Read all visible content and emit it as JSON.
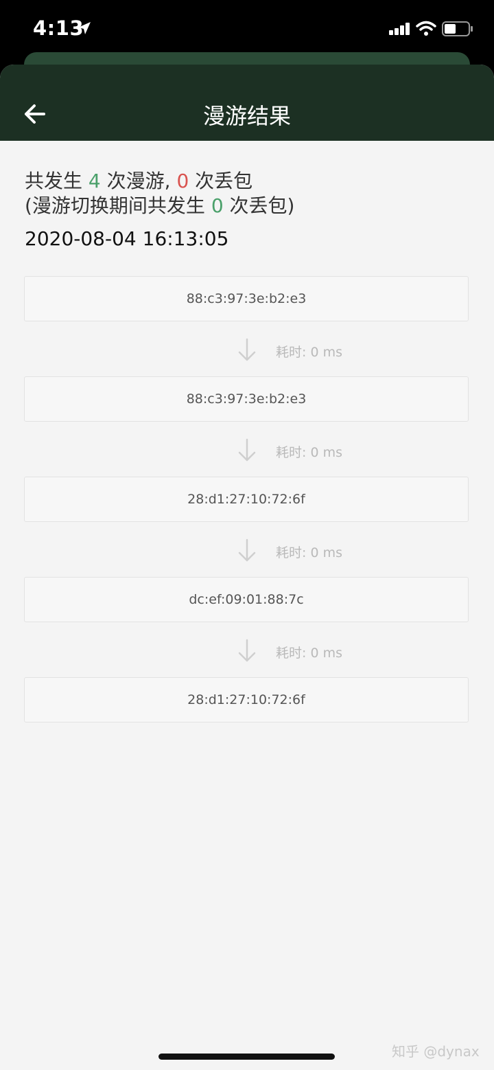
{
  "status_bar": {
    "time": "4:13",
    "icons": [
      "location-arrow-icon",
      "cellular-signal-icon",
      "wifi-icon",
      "battery-icon"
    ]
  },
  "nav": {
    "title": "漫游结果",
    "back_icon": "arrow-left-icon"
  },
  "summary": {
    "line1_prefix": "共发生 ",
    "roam_count": "4",
    "line1_mid": " 次漫游, ",
    "loss_count": "0",
    "line1_suffix": " 次丢包",
    "line2_prefix": "(漫游切换期间共发生 ",
    "switch_loss_count": "0",
    "line2_suffix": " 次丢包)",
    "datetime": "2020-08-04 16:13:05"
  },
  "nodes": [
    {
      "mac": "88:c3:97:3e:b2:e3"
    },
    {
      "mac": "88:c3:97:3e:b2:e3"
    },
    {
      "mac": "28:d1:27:10:72:6f"
    },
    {
      "mac": "dc:ef:09:01:88:7c"
    },
    {
      "mac": "28:d1:27:10:72:6f"
    }
  ],
  "transitions": [
    {
      "duration": "耗时: 0 ms"
    },
    {
      "duration": "耗时: 0 ms"
    },
    {
      "duration": "耗时: 0 ms"
    },
    {
      "duration": "耗时: 0 ms"
    }
  ],
  "watermark": "知乎 @dynax",
  "colors": {
    "nav_bg": "#1c3023",
    "accent_green": "#4aa06a",
    "accent_red": "#d9534f",
    "page_bg": "#f4f4f4"
  }
}
